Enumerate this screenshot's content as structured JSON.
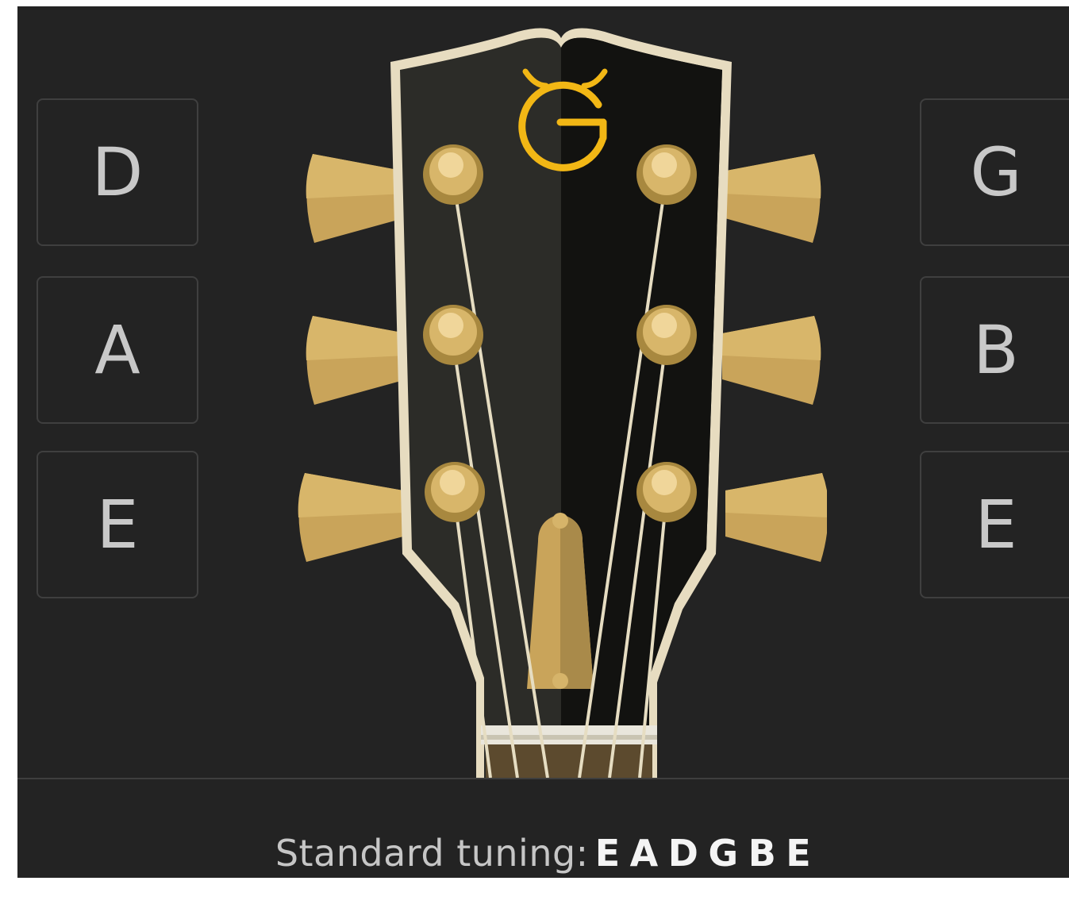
{
  "strings": {
    "left": [
      {
        "note": "D"
      },
      {
        "note": "A"
      },
      {
        "note": "E"
      }
    ],
    "right": [
      {
        "note": "G"
      },
      {
        "note": "B"
      },
      {
        "note": "E"
      }
    ]
  },
  "logo": {
    "letter": "G",
    "color": "#f2b715"
  },
  "tuning": {
    "label": "Standard tuning:",
    "notes": [
      "E",
      "A",
      "D",
      "G",
      "B",
      "E"
    ]
  },
  "colors": {
    "background": "#232323",
    "headstock_left": "#2c2c28",
    "headstock_right": "#121210",
    "binding": "#e7dcc0",
    "hardware_gold": "#c9a45a"
  }
}
